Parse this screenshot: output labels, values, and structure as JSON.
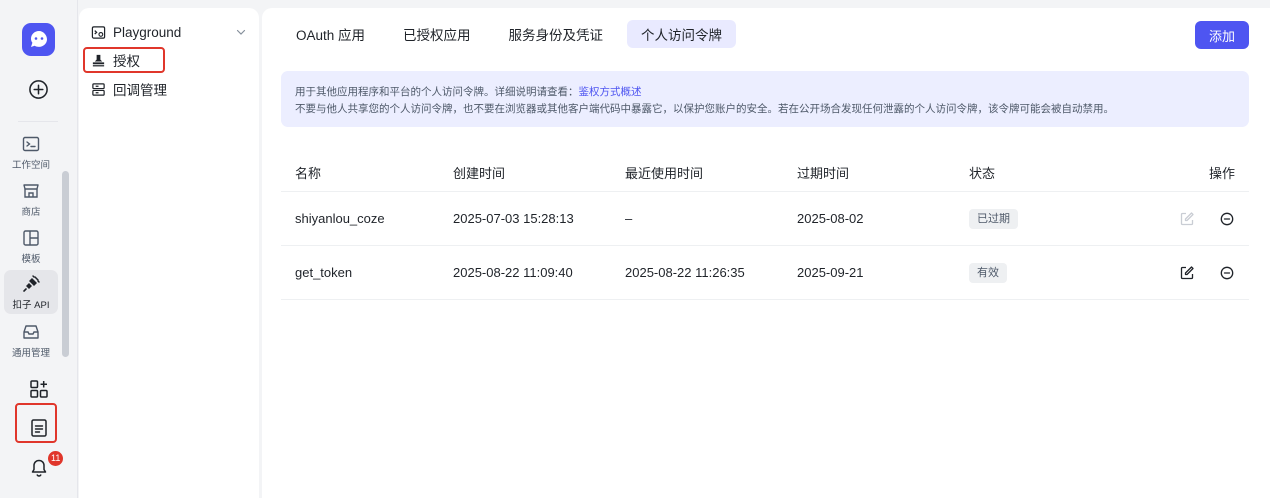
{
  "rail": {
    "items": [
      {
        "label": "工作空间",
        "icon": "terminal-icon"
      },
      {
        "label": "商店",
        "icon": "store-icon"
      },
      {
        "label": "模板",
        "icon": "template-icon"
      },
      {
        "label": "扣子 API",
        "icon": "plug-icon"
      },
      {
        "label": "通用管理",
        "icon": "inbox-icon"
      }
    ],
    "notification_count": "11"
  },
  "subnav": {
    "items": [
      {
        "label": "Playground"
      },
      {
        "label": "授权"
      },
      {
        "label": "回调管理"
      }
    ]
  },
  "tabs": [
    {
      "label": "OAuth 应用"
    },
    {
      "label": "已授权应用"
    },
    {
      "label": "服务身份及凭证"
    },
    {
      "label": "个人访问令牌"
    }
  ],
  "add_button": "添加",
  "notice": {
    "line1": "用于其他应用程序和平台的个人访问令牌。详细说明请查看：",
    "link": "鉴权方式概述",
    "line2": "不要与他人共享您的个人访问令牌，也不要在浏览器或其他客户端代码中暴露它，以保护您账户的安全。若在公开场合发现任何泄露的个人访问令牌，该令牌可能会被自动禁用。"
  },
  "table": {
    "headers": [
      "名称",
      "创建时间",
      "最近使用时间",
      "过期时间",
      "状态",
      "操作"
    ],
    "rows": [
      {
        "name": "shiyanlou_coze",
        "created": "2025-07-03 15:28:13",
        "last_used": "–",
        "expires": "2025-08-02",
        "status": "已过期"
      },
      {
        "name": "get_token",
        "created": "2025-08-22 11:09:40",
        "last_used": "2025-08-22 11:26:35",
        "expires": "2025-09-21",
        "status": "有效"
      }
    ]
  },
  "colors": {
    "accent": "#4e55f1",
    "highlight_box": "#e0362b"
  }
}
